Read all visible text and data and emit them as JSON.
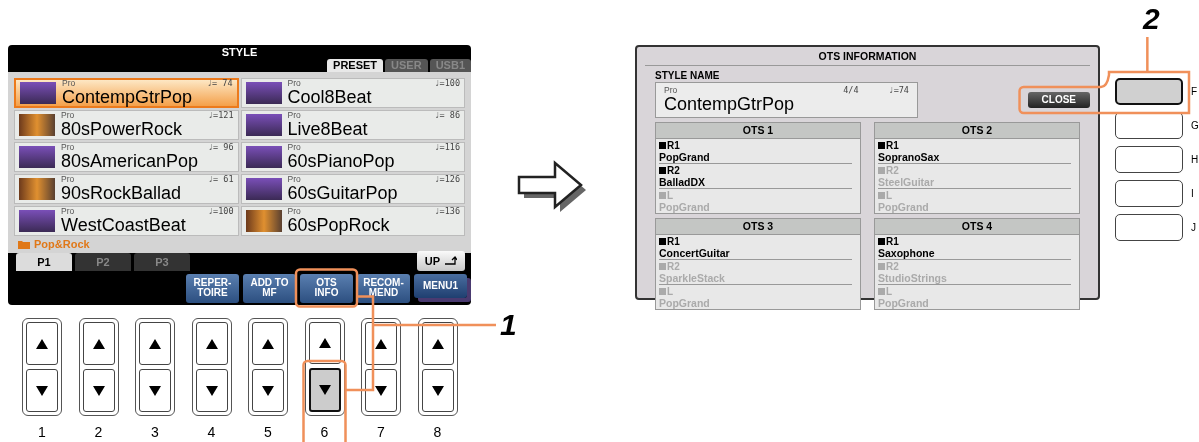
{
  "style_screen": {
    "title": "STYLE",
    "tabs": [
      {
        "label": "PRESET",
        "selected": true
      },
      {
        "label": "USER",
        "selected": false
      },
      {
        "label": "USB1",
        "selected": false
      }
    ],
    "styles": [
      {
        "label": "Pro",
        "tempo": "♩= 74",
        "name": "ContempGtrPop",
        "kind": "microphone",
        "selected": true
      },
      {
        "label": "Pro",
        "tempo": "♩=100",
        "name": "Cool8Beat",
        "kind": "microphone",
        "selected": false
      },
      {
        "label": "Pro",
        "tempo": "♩=121",
        "name": "80sPowerRock",
        "kind": "guitar",
        "selected": false
      },
      {
        "label": "Pro",
        "tempo": "♩= 86",
        "name": "Live8Beat",
        "kind": "microphone",
        "selected": false
      },
      {
        "label": "Pro",
        "tempo": "♩= 96",
        "name": "80sAmericanPop",
        "kind": "microphone",
        "selected": false
      },
      {
        "label": "Pro",
        "tempo": "♩=116",
        "name": "60sPianoPop",
        "kind": "microphone",
        "selected": false
      },
      {
        "label": "Pro",
        "tempo": "♩= 61",
        "name": "90sRockBallad",
        "kind": "guitar",
        "selected": false
      },
      {
        "label": "Pro",
        "tempo": "♩=126",
        "name": "60sGuitarPop",
        "kind": "microphone",
        "selected": false
      },
      {
        "label": "Pro",
        "tempo": "♩=100",
        "name": "WestCoastBeat",
        "kind": "microphone",
        "selected": false
      },
      {
        "label": "Pro",
        "tempo": "♩=136",
        "name": "60sPopRock",
        "kind": "guitar",
        "selected": false
      }
    ],
    "category": "Pop&Rock",
    "pages": [
      {
        "label": "P1",
        "selected": true
      },
      {
        "label": "P2",
        "selected": false
      },
      {
        "label": "P3",
        "selected": false
      }
    ],
    "up_button": "UP",
    "buttons": [
      {
        "lines": [
          "REPER-",
          "TOIRE"
        ],
        "kind": "function"
      },
      {
        "lines": [
          "ADD TO",
          "MF"
        ],
        "kind": "function"
      },
      {
        "lines": [
          "OTS",
          "INFO"
        ],
        "kind": "function"
      },
      {
        "lines": [
          "RECOM-",
          "MEND"
        ],
        "kind": "function"
      },
      {
        "lines": [
          "MENU1"
        ],
        "kind": "menu"
      }
    ]
  },
  "panel_buttons": [
    {
      "number": "1",
      "down_pressed": false
    },
    {
      "number": "2",
      "down_pressed": false
    },
    {
      "number": "3",
      "down_pressed": false
    },
    {
      "number": "4",
      "down_pressed": false
    },
    {
      "number": "5",
      "down_pressed": false
    },
    {
      "number": "6",
      "down_pressed": true
    },
    {
      "number": "7",
      "down_pressed": false
    },
    {
      "number": "8",
      "down_pressed": false
    }
  ],
  "ots_screen": {
    "title": "OTS INFORMATION",
    "style_name_label": "STYLE NAME",
    "style": {
      "label": "Pro",
      "time_signature": "4/4",
      "tempo": "♩=74",
      "name": "ContempGtrPop"
    },
    "close_button": "CLOSE",
    "ots": [
      {
        "title": "OTS 1",
        "parts": [
          {
            "part": "R1",
            "voice": "PopGrand",
            "on": true
          },
          {
            "part": "R2",
            "voice": "BalladDX",
            "on": true
          },
          {
            "part": "L",
            "voice": "PopGrand",
            "on": false
          }
        ]
      },
      {
        "title": "OTS 2",
        "parts": [
          {
            "part": "R1",
            "voice": "SopranoSax",
            "on": true
          },
          {
            "part": "R2",
            "voice": "SteelGuitar",
            "on": false
          },
          {
            "part": "L",
            "voice": "PopGrand",
            "on": false
          }
        ]
      },
      {
        "title": "OTS 3",
        "parts": [
          {
            "part": "R1",
            "voice": "ConcertGuitar",
            "on": true
          },
          {
            "part": "R2",
            "voice": "SparkleStack",
            "on": false
          },
          {
            "part": "L",
            "voice": "PopGrand",
            "on": false
          }
        ]
      },
      {
        "title": "OTS 4",
        "parts": [
          {
            "part": "R1",
            "voice": "Saxophone",
            "on": true
          },
          {
            "part": "R2",
            "voice": "StudioStrings",
            "on": false
          },
          {
            "part": "L",
            "voice": "PopGrand",
            "on": false
          }
        ]
      }
    ]
  },
  "side_buttons": [
    {
      "label": "F",
      "pressed": true
    },
    {
      "label": "G",
      "pressed": false
    },
    {
      "label": "H",
      "pressed": false
    },
    {
      "label": "I",
      "pressed": false
    },
    {
      "label": "J",
      "pressed": false
    }
  ],
  "steps": [
    "1",
    "2"
  ]
}
